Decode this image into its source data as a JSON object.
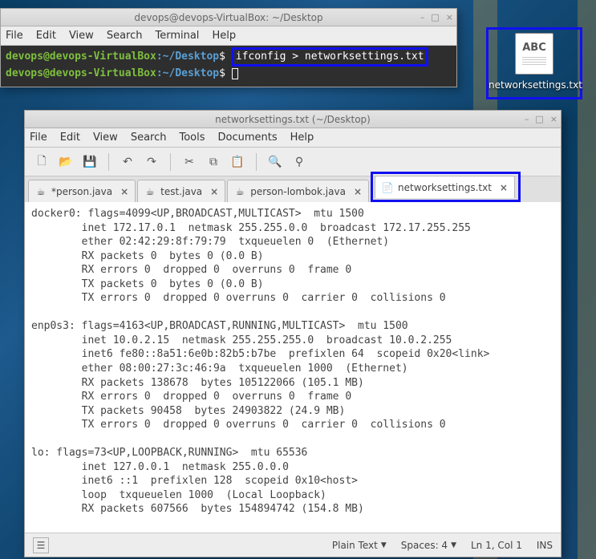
{
  "desktop": {
    "icon_text": "ABC",
    "icon_label": "networksettings.txt"
  },
  "terminal": {
    "title": "devops@devops-VirtualBox: ~/Desktop",
    "menus": [
      "File",
      "Edit",
      "View",
      "Search",
      "Terminal",
      "Help"
    ],
    "win_controls": [
      "–",
      "□",
      "×"
    ],
    "lines": [
      {
        "user": "devops@devops-VirtualBox",
        "sep": ":",
        "path": "~/Desktop",
        "dollar": "$",
        "cmd": "ifconfig  > networksettings.txt"
      },
      {
        "user": "devops@devops-VirtualBox",
        "sep": ":",
        "path": "~/Desktop",
        "dollar": "$",
        "cmd": ""
      }
    ]
  },
  "editor": {
    "title": "networksettings.txt (~/Desktop)",
    "win_controls": [
      "–",
      "□",
      "×"
    ],
    "menus": [
      "File",
      "Edit",
      "View",
      "Search",
      "Tools",
      "Documents",
      "Help"
    ],
    "toolbar_icons": {
      "new": "🗋",
      "open": "📂",
      "save": "💾",
      "undo": "↶",
      "redo": "↷",
      "cut": "✂",
      "copy": "⧉",
      "paste": "📋",
      "search": "🔍",
      "replace": "⚲"
    },
    "tabs": [
      {
        "icon": "☕",
        "label": "*person.java",
        "active": false
      },
      {
        "icon": "☕",
        "label": "test.java",
        "active": false
      },
      {
        "icon": "☕",
        "label": "person-lombok.java",
        "active": false
      },
      {
        "icon": "📄",
        "label": "networksettings.txt",
        "active": true
      }
    ],
    "content": "docker0: flags=4099<UP,BROADCAST,MULTICAST>  mtu 1500\n        inet 172.17.0.1  netmask 255.255.0.0  broadcast 172.17.255.255\n        ether 02:42:29:8f:79:79  txqueuelen 0  (Ethernet)\n        RX packets 0  bytes 0 (0.0 B)\n        RX errors 0  dropped 0  overruns 0  frame 0\n        TX packets 0  bytes 0 (0.0 B)\n        TX errors 0  dropped 0 overruns 0  carrier 0  collisions 0\n\nenp0s3: flags=4163<UP,BROADCAST,RUNNING,MULTICAST>  mtu 1500\n        inet 10.0.2.15  netmask 255.255.255.0  broadcast 10.0.2.255\n        inet6 fe80::8a51:6e0b:82b5:b7be  prefixlen 64  scopeid 0x20<link>\n        ether 08:00:27:3c:46:9a  txqueuelen 1000  (Ethernet)\n        RX packets 138678  bytes 105122066 (105.1 MB)\n        RX errors 0  dropped 0  overruns 0  frame 0\n        TX packets 90458  bytes 24903822 (24.9 MB)\n        TX errors 0  dropped 0 overruns 0  carrier 0  collisions 0\n\nlo: flags=73<UP,LOOPBACK,RUNNING>  mtu 65536\n        inet 127.0.0.1  netmask 255.0.0.0\n        inet6 ::1  prefixlen 128  scopeid 0x10<host>\n        loop  txqueuelen 1000  (Local Loopback)\n        RX packets 607566  bytes 154894742 (154.8 MB)",
    "status": {
      "mode": "Plain Text",
      "spaces": "Spaces: 4",
      "pos": "Ln 1, Col 1",
      "ins": "INS"
    }
  }
}
